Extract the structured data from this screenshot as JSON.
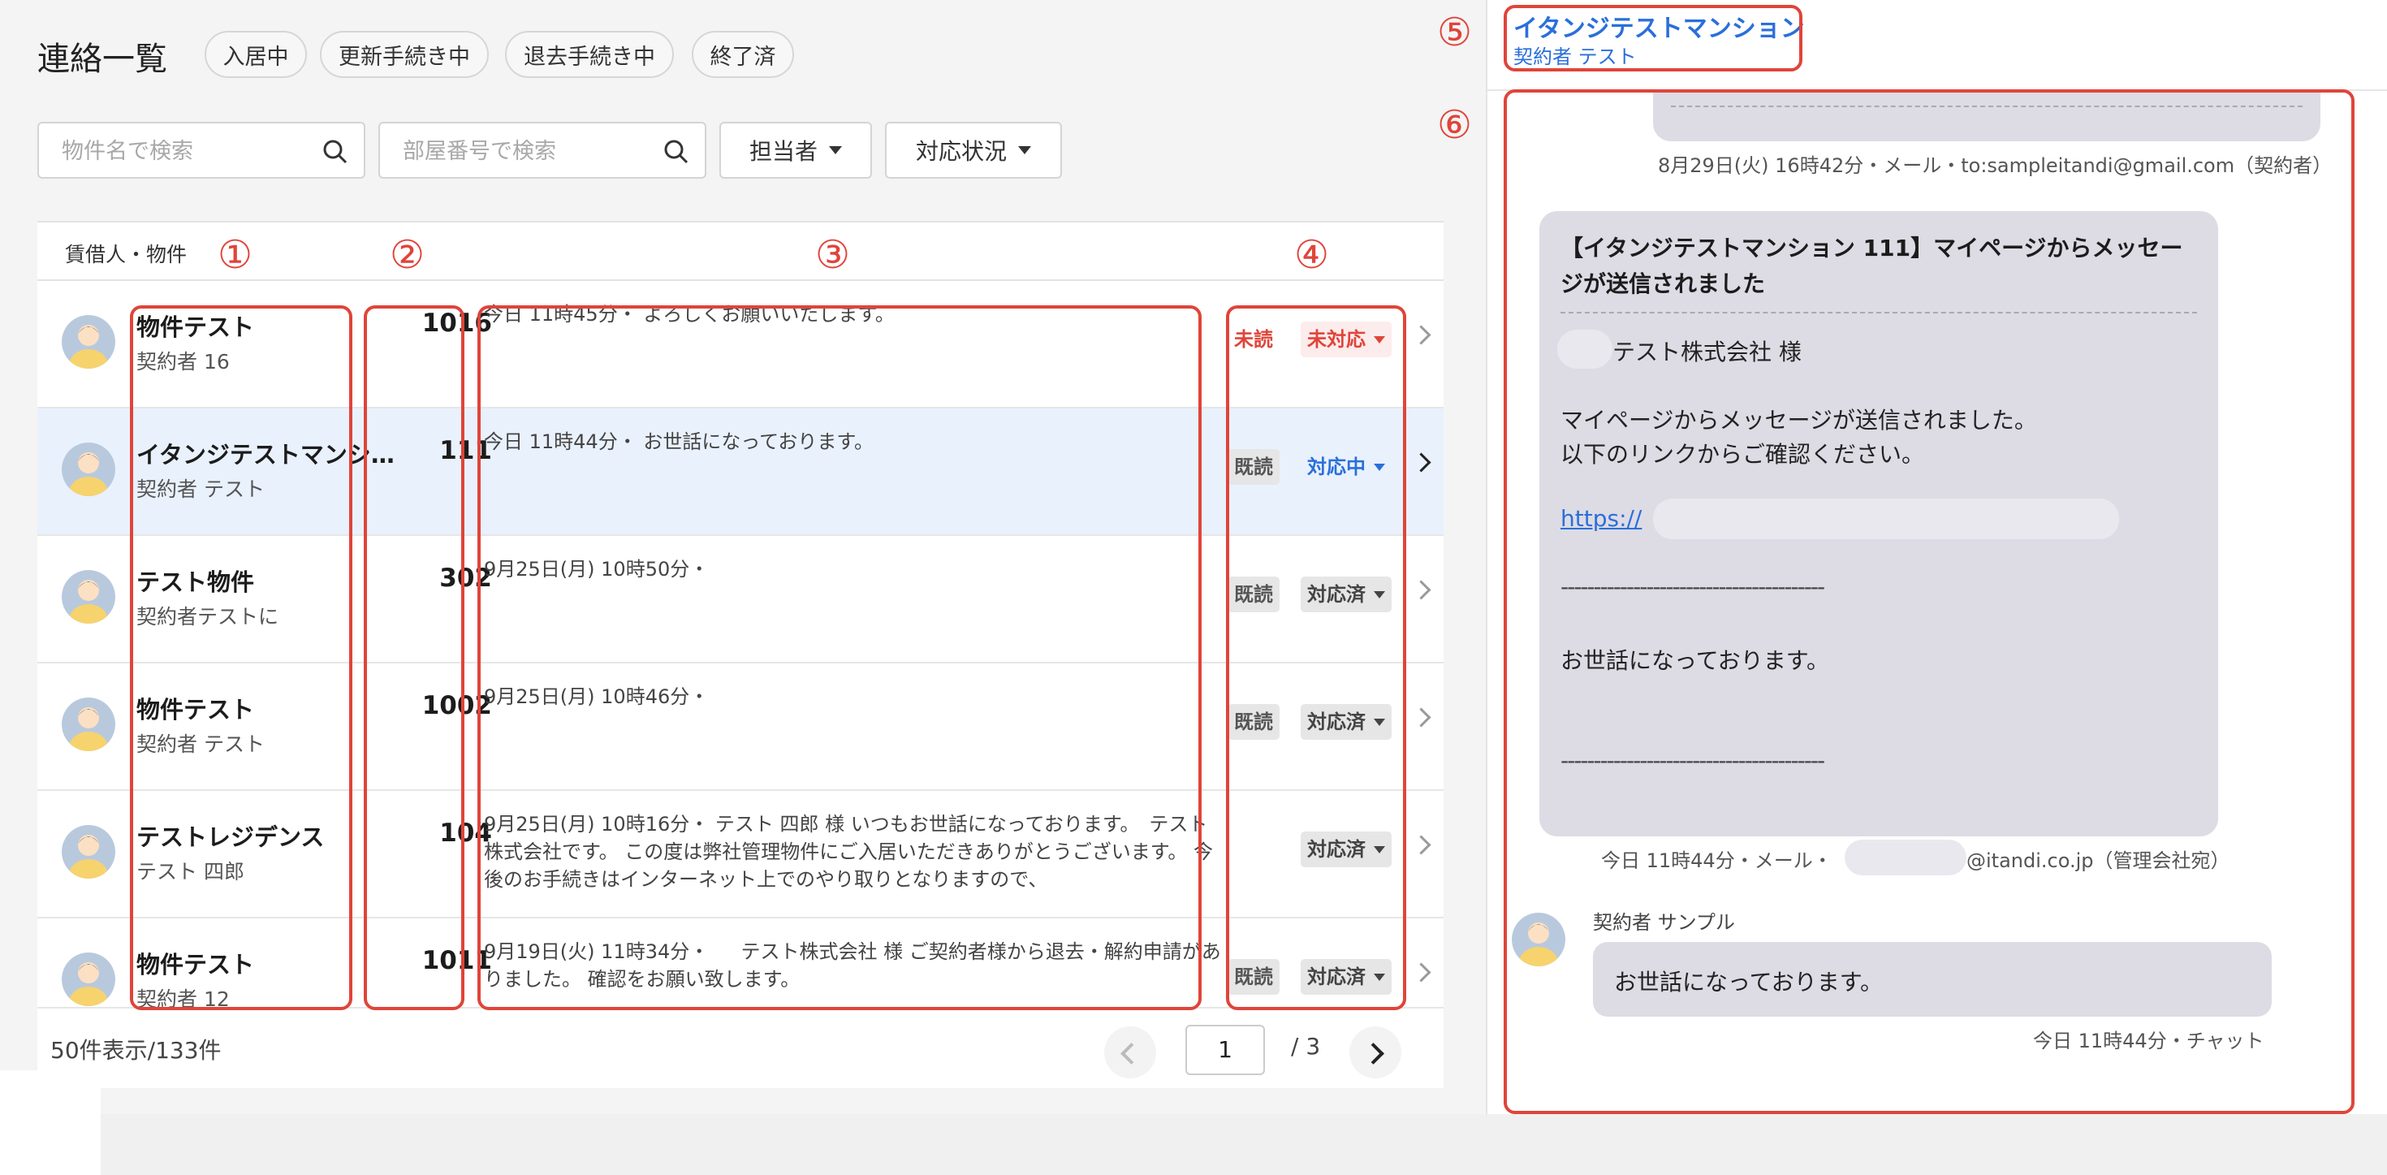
{
  "header": {
    "title": "連絡一覧",
    "chips": [
      "入居中",
      "更新手続き中",
      "退去手続き中",
      "終了済"
    ]
  },
  "filters": {
    "property_placeholder": "物件名で検索",
    "room_placeholder": "部屋番号で検索",
    "assignee_label": "担当者",
    "status_label": "対応状況"
  },
  "table": {
    "column_header": "賃借人・物件",
    "rows": [
      {
        "name": "物件テスト",
        "sub": "契約者 16",
        "room": "1016",
        "message": "今日 11時45分・ よろしくお願いいたします。",
        "read": "未読",
        "status": "未対応"
      },
      {
        "name": "イタンジテストマンション",
        "sub": "契約者 テスト",
        "room": "111",
        "message": "今日 11時44分・ お世話になっております。",
        "read": "既読",
        "status": "対応中"
      },
      {
        "name": "テスト物件",
        "sub": "契約者テストに",
        "room": "302",
        "message": "9月25日(月) 10時50分・",
        "read": "既読",
        "status": "対応済"
      },
      {
        "name": "物件テスト",
        "sub": "契約者 テスト",
        "room": "1002",
        "message": "9月25日(月) 10時46分・",
        "read": "既読",
        "status": "対応済"
      },
      {
        "name": "テストレジデンス",
        "sub": "テスト 四郎",
        "room": "104",
        "message": "9月25日(月) 10時16分・ テスト 四郎 様 いつもお世話になっております。　テスト株式会社です。 この度は弊社管理物件にご入居いただきありがとうございます。 今後のお手続きはインターネット上でのやり取りとなりますので、",
        "read": "",
        "status": "対応済"
      },
      {
        "name": "物件テスト",
        "sub": "契約者 12",
        "room": "1011",
        "message": "9月19日(火) 11時34分・ 　 テスト株式会社 様 ご契約者様から退去・解約申請がありました。 確認をお願い致します。",
        "read": "既読",
        "status": "対応済"
      }
    ]
  },
  "pagination": {
    "count": "50件表示/133件",
    "current": "1",
    "total": "/ 3"
  },
  "detail": {
    "title": "イタンジテストマンション",
    "sub": "契約者 テスト",
    "meta_top": "8月29日(火) 16時42分・メール・to:sampleitandi@gmail.com（契約者）",
    "mail_title": "【イタンジテストマンション 111】マイページからメッセージが送信されました",
    "mail_to": "テスト株式会社 様",
    "mail_line1": "マイページからメッセージが送信されました。",
    "mail_line2": "以下のリンクからご確認ください。",
    "mail_link": "https://",
    "separator": "----------------------------------------",
    "mail_body": "お世話になっております。",
    "meta_mail_prefix": "今日 11時44分・メール・",
    "meta_mail_suffix": "@itandi.co.jp（管理会社宛）",
    "chat_name": "契約者 サンプル",
    "chat_msg": "お世話になっております。",
    "chat_meta": "今日 11時44分・チャット"
  },
  "annotations": [
    "①",
    "②",
    "③",
    "④",
    "⑤",
    "⑥"
  ],
  "colors": {
    "annotation": "#e0443a",
    "link": "#2a6fdb",
    "selected_row": "#e9f1fd",
    "bubble": "#dddbe4"
  }
}
